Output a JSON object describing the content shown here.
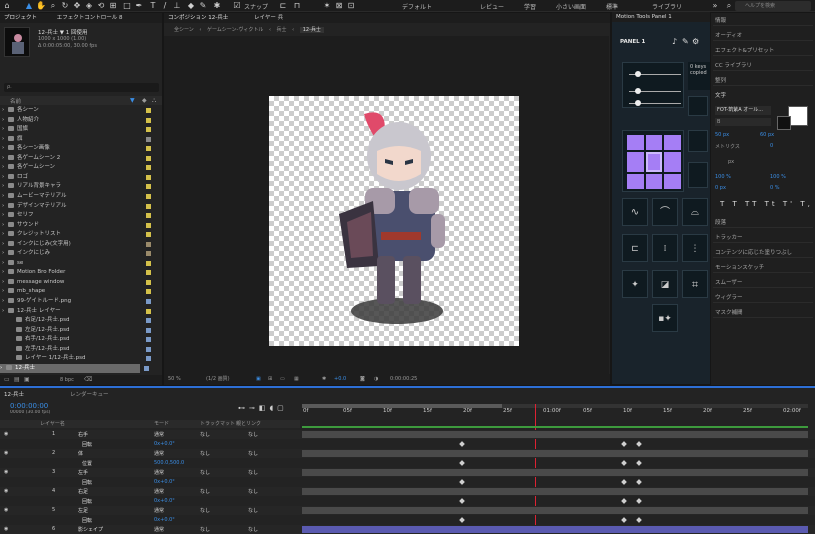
{
  "topbar": {
    "snap_label": "スナップ",
    "workspaces": [
      "デフォルト",
      "レビュー",
      "学習",
      "小さい画面",
      "標準",
      "ライブラリ"
    ],
    "search_placeholder": "ヘルプを検索"
  },
  "project_panel": {
    "tab_label": "プロジェクト",
    "tab2_label": "エフェクトコントロール 8",
    "comp_name": "12-兵士 ▼ 1 回使用",
    "comp_size": "1000 x 1000 (1.00)",
    "comp_duration": "Δ 0:00:05:00, 30.00 fps",
    "search_placeholder": "ρ.",
    "col_name": "名前",
    "items": [
      "各シーン",
      "人物紹介",
      "国旗",
      "旗",
      "各シーン画像",
      "各ゲームシーン 2",
      "各ゲームシーン",
      "ロゴ",
      "リアル背景キャラ",
      "ムービーマテリアル",
      "デザインマテリアル",
      "セリフ",
      "サウンド",
      "クレジットリスト",
      "インクにじみ(文字用)",
      "インクにじみ",
      "se",
      "Motion Bro Folder",
      "message window",
      "mb_shape",
      "99-ゲイトルード.png",
      "12-兵士 レイヤー",
      "右足/12-兵士.psd",
      "左足/12-兵士.psd",
      "右手/12-兵士.psd",
      "左手/12-兵士.psd",
      "レイヤー 1/12-兵士.psd",
      "12-兵士"
    ],
    "bpc": "8 bpc"
  },
  "comp_panel": {
    "tab_label": "コンポジション 12-兵士",
    "tab2_label": "レイヤー 兵",
    "breadcrumbs": [
      "全シーン",
      "ゲームシーン-ヴィクトル",
      "兵士",
      "12-兵士"
    ],
    "zoom": "50 %",
    "resolution": "(1/2 画質)",
    "exposure": "+0.0",
    "timecode": "0:00:00:25"
  },
  "motion_tools": {
    "tab_label": "Motion Tools Panel 1",
    "panel_label": "PANEL 1",
    "kf_text1": "0 keys",
    "kf_text2": "copied",
    "colors": {
      "accent": "#a57ef5",
      "bg": "#19232b"
    }
  },
  "right_panel": {
    "items_top": [
      "情報",
      "オーディオ",
      "エフェクト&プリセット",
      "CC ライブラリ",
      "整列",
      "文字"
    ],
    "font": "FOT-筑紫A オール...",
    "font_size": "50 px",
    "leading": "60 px",
    "kerning": "メトリクス",
    "tracking": "0",
    "unit": "px",
    "vscale": "100 %",
    "hscale": "100 %",
    "baseline": "0 px",
    "tsume": "0 %",
    "items_bottom": [
      "段落",
      "トラッカー",
      "コンテンツに応じた塗りつぶし",
      "モーションスケッチ",
      "スムーザー",
      "ウィグラー",
      "マスク補間"
    ]
  },
  "timeline": {
    "tab_label": "12-兵士",
    "tab2_label": "レンダーキュー",
    "timecode": "0:00:00:00",
    "timecode_sub": "00000 (30.00 fps)",
    "col_name": "レイヤー名",
    "col_mode": "モード",
    "col_trkmat": "トラックマット",
    "col_parent": "親とリンク",
    "ticks": [
      "0f",
      "05f",
      "10f",
      "15f",
      "20f",
      "25f",
      "01:00f",
      "05f",
      "10f",
      "15f",
      "20f",
      "25f",
      "02:00f"
    ],
    "rows": [
      {
        "num": "1",
        "name": "右手",
        "mode": "通常",
        "parent": "なし"
      },
      {
        "num": "",
        "name": "回転",
        "mode": "0x+0.0°",
        "parent": ""
      },
      {
        "num": "2",
        "name": "体",
        "mode": "通常",
        "parent": "なし"
      },
      {
        "num": "",
        "name": "位置",
        "mode": "500.0,500.0",
        "parent": ""
      },
      {
        "num": "3",
        "name": "左手",
        "mode": "通常",
        "parent": "なし"
      },
      {
        "num": "",
        "name": "回転",
        "mode": "0x+0.0°",
        "parent": ""
      },
      {
        "num": "4",
        "name": "右足",
        "mode": "通常",
        "parent": "なし"
      },
      {
        "num": "",
        "name": "回転",
        "mode": "0x+0.0°",
        "parent": ""
      },
      {
        "num": "5",
        "name": "左足",
        "mode": "通常",
        "parent": "なし"
      },
      {
        "num": "",
        "name": "回転",
        "mode": "0x+0.0°",
        "parent": ""
      },
      {
        "num": "6",
        "name": "影シェイプ",
        "mode": "通常",
        "parent": "なし"
      }
    ],
    "trkmat_value": "なし"
  }
}
